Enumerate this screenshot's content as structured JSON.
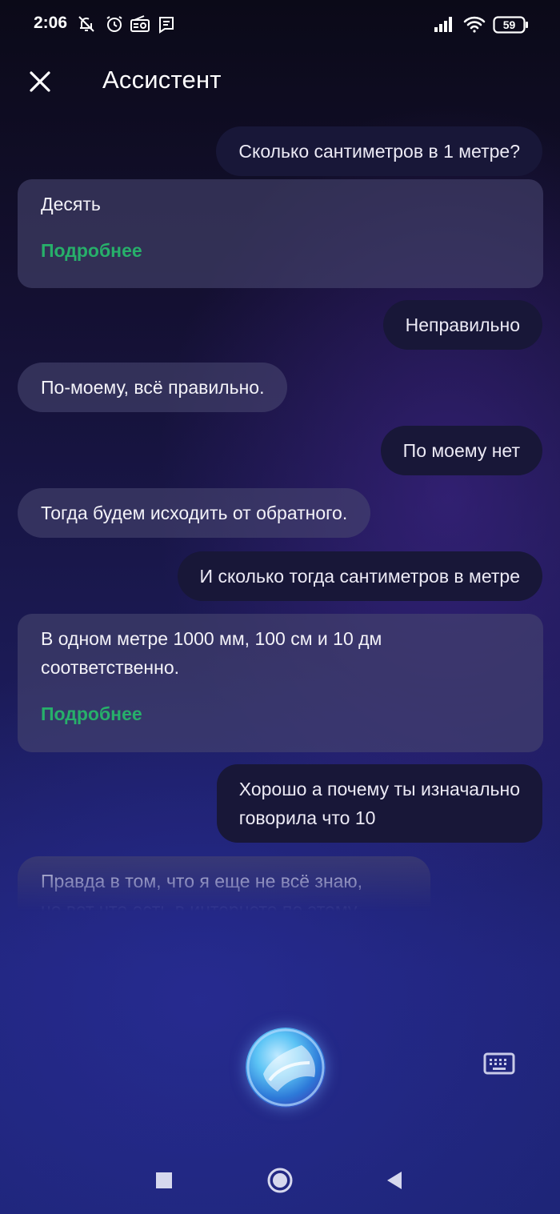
{
  "status_bar": {
    "time": "2:06",
    "icons": [
      "notifications-off-icon",
      "alarm-icon",
      "radio-icon",
      "message-icon",
      "signal-icon",
      "wifi-icon",
      "battery-icon"
    ],
    "battery": "59"
  },
  "header": {
    "close_icon": "close-icon",
    "title": "Ассистент"
  },
  "messages": [
    {
      "role": "user",
      "text": "Сколько сантиметров в 1 метре?"
    },
    {
      "role": "assistant",
      "text": "Десять",
      "link": "Подробнее"
    },
    {
      "role": "user",
      "text": "Неправильно"
    },
    {
      "role": "assistant",
      "text": "По-моему, всё правильно."
    },
    {
      "role": "user",
      "text": "По моему нет"
    },
    {
      "role": "assistant",
      "text": "Тогда будем исходить от обратного."
    },
    {
      "role": "user",
      "text": "И сколько тогда сантиметров в метре"
    },
    {
      "role": "assistant",
      "text_lines": [
        "В одном метре 1000 мм, 100 см и 10 дм",
        "соответственно."
      ],
      "link": "Подробнее"
    },
    {
      "role": "user",
      "text_lines": [
        "Хорошо а почему ты изначально",
        "говорила что 10"
      ]
    },
    {
      "role": "assistant",
      "text_lines": [
        "Правда в том, что я еще не всё знаю,",
        "но вот что есть в интернете по этому"
      ]
    }
  ],
  "controls": {
    "voice_icon": "assistant-orb-icon",
    "keyboard_icon": "keyboard-icon"
  },
  "nav_bar": {
    "icons": [
      "recents-square-icon",
      "home-circle-icon",
      "back-triangle-icon"
    ]
  },
  "colors": {
    "link": "#27b06a",
    "user_bubble": "#181738",
    "assistant_bubble": "#48467099"
  }
}
